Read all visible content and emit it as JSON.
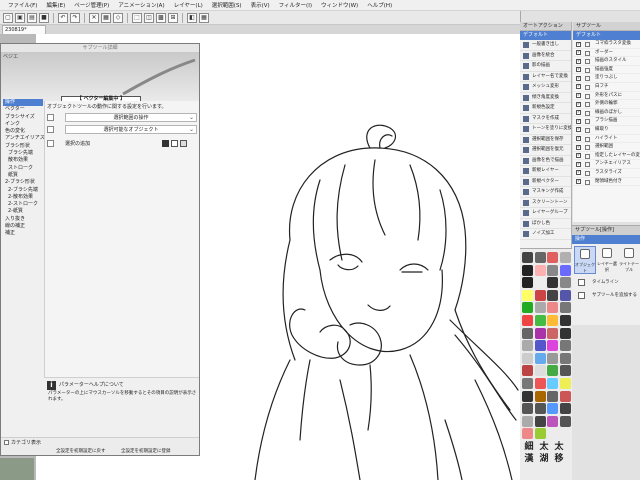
{
  "menu": [
    "ファイル(F)",
    "編集(E)",
    "ページ管理(P)",
    "アニメーション(A)",
    "レイヤー(L)",
    "選択範囲(S)",
    "表示(V)",
    "フィルター(I)",
    "ウィンドウ(W)",
    "ヘルプ(H)"
  ],
  "doc_tab": "230819*",
  "dialog": {
    "title": "サブツール詳細",
    "preview_label": "ベジエ",
    "editing": "【 ベクター編集中 】",
    "categories": [
      {
        "label": "操作",
        "active": true,
        "sub": false
      },
      {
        "label": "ベクター",
        "active": false,
        "sub": false
      },
      {
        "label": "ブラシサイズ",
        "active": false,
        "sub": false
      },
      {
        "label": "インク",
        "active": false,
        "sub": false
      },
      {
        "label": "色の変化",
        "active": false,
        "sub": false
      },
      {
        "label": "アンチエイリアス",
        "active": false,
        "sub": false
      },
      {
        "label": "ブラシ形状",
        "active": false,
        "sub": false
      },
      {
        "label": "ブラシ先端",
        "active": false,
        "sub": true
      },
      {
        "label": "散布効果",
        "active": false,
        "sub": true
      },
      {
        "label": "ストローク",
        "active": false,
        "sub": true
      },
      {
        "label": "紙質",
        "active": false,
        "sub": true
      },
      {
        "label": "2-ブラシ形状",
        "active": false,
        "sub": false
      },
      {
        "label": "2-ブラシ先端",
        "active": false,
        "sub": true
      },
      {
        "label": "2-散布効果",
        "active": false,
        "sub": true
      },
      {
        "label": "2-ストローク",
        "active": false,
        "sub": true
      },
      {
        "label": "2-紙質",
        "active": false,
        "sub": true
      },
      {
        "label": "入り抜き",
        "active": false,
        "sub": false
      },
      {
        "label": "線の補正",
        "active": false,
        "sub": false
      },
      {
        "label": "補正",
        "active": false,
        "sub": false
      }
    ],
    "description": "オブジェクトツールの動作に関する設定を行います。",
    "select_1": "選択範囲の操作",
    "select_2": "選択可能なオブジェクト",
    "add_label": "選択の追加",
    "help_title": "パラメーターヘルプについて",
    "help_body": "パラメーターの上にマウスカーソルを移動するとその項目の説明が表示されます。",
    "category_show": "カテゴリ表示",
    "reset_initial": "全設定を初期設定に戻す",
    "register_initial": "全設定を初期設定に登録"
  },
  "auto_actions": {
    "tab": "オートアクション",
    "header": "デフォルト",
    "items": [
      "一般書き出し",
      "画像を統合",
      "影の描画",
      "レイヤー名で変換",
      "メッシュ変形",
      "傾き角度変換",
      "新規色設定",
      "マスクを作成",
      "トーンを塗りに変換",
      "選択範囲を保存",
      "選択範囲を復元",
      "画像を色で描画",
      "新規レイヤー",
      "新規ベクター",
      "マスキング作成",
      "スクリーントーン",
      "レイヤーグループ",
      "ぼかし色",
      "ノイズ加工"
    ]
  },
  "material": {
    "tab": "サブツール",
    "header": "デフォルト",
    "items": [
      "コマ枠ラスタ変換",
      "ボーダー",
      "描画のスタイル",
      "描画強度",
      "塗りつぶし",
      "白フチ",
      "外形をパスに",
      "外側の輪郭",
      "線画のぼかし",
      "ブラシ描画",
      "縁取り",
      "ハイライト",
      "選択範囲",
      "指定したレイヤーの変更",
      "アンチエイリアス",
      "ラスタライズ",
      "閉領域色付き"
    ]
  },
  "subtool_panel": {
    "tab": "サブツール[操作]",
    "header": "操作",
    "btn_object": "オブジェクト",
    "btn_layer": "レイヤー選択",
    "btn_light": "ライトテーブル",
    "timeline": "タイムライン",
    "add_subtool": "サブツールを追加する"
  },
  "tool_colors": [
    "#444",
    "#666",
    "#e06060",
    "#b0b0b0",
    "#222",
    "#ffb0b0",
    "#888",
    "#6a6aff",
    "#222",
    "#eee",
    "#333",
    "#888",
    "#ff6",
    "#c44",
    "#444",
    "#55a",
    "#2a2",
    "#aaa",
    "#e88",
    "#777",
    "#e44",
    "#4b4",
    "#fb3",
    "#333",
    "#666",
    "#a3a",
    "#c66",
    "#333",
    "#aaa",
    "#55c",
    "#d4d",
    "#777",
    "#ccc",
    "#6ae",
    "#999",
    "#777",
    "#b44",
    "#ddd",
    "#4a4",
    "#555",
    "#777",
    "#e55",
    "#6cf",
    "#ee5",
    "#333",
    "#a60",
    "#666",
    "#c55",
    "#555",
    "#555",
    "#59f",
    "#444",
    "#aaa",
    "#444",
    "#b5b",
    "#555",
    "#e88",
    "#9c3"
  ],
  "chars": [
    "細",
    "太",
    "太",
    "漢",
    "湖",
    "移"
  ]
}
